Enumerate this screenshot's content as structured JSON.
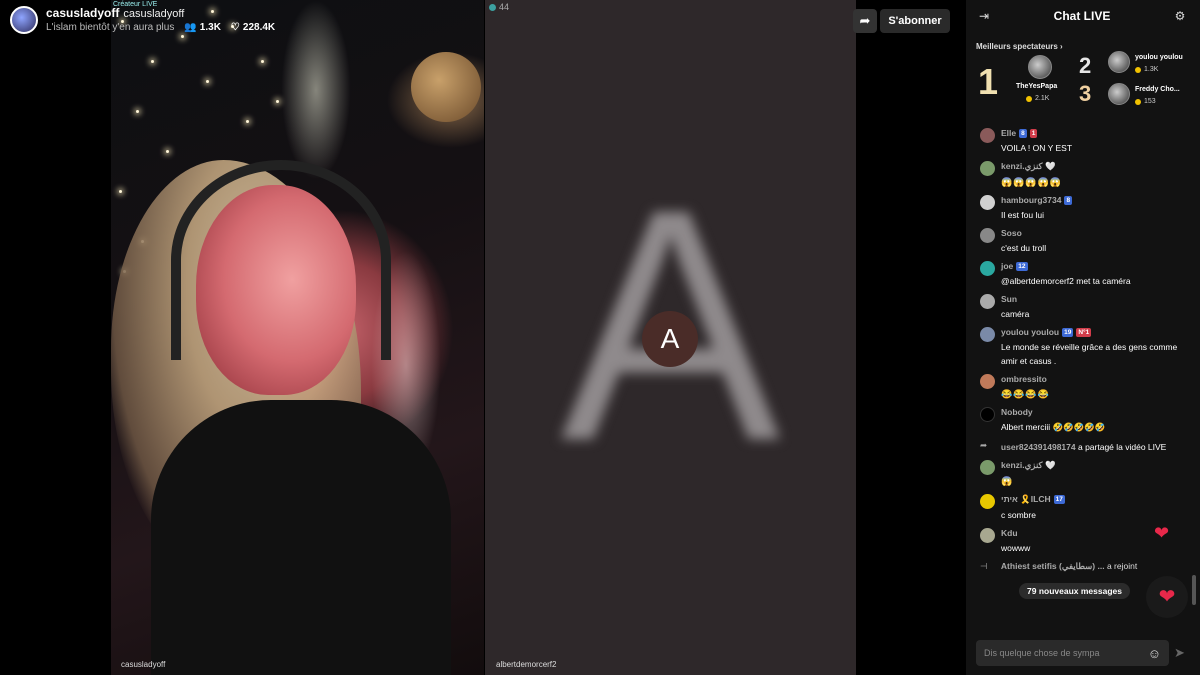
{
  "host": {
    "name": "casusladyoff",
    "handle": "casusladyoff",
    "creator_tag": "Créateur LIVE",
    "description": "L'islam bientôt y'en aura plus",
    "followers": "1.3K",
    "likes": "228.4K"
  },
  "video": {
    "left_label": "casusladyoff",
    "right_label": "albertdemorcerf2",
    "right_viewers": "44",
    "guest_initial": "A",
    "big_letter": "A"
  },
  "actions": {
    "subscribe_label": "S'abonner"
  },
  "chat": {
    "title": "Chat LIVE",
    "top_title": "Meilleurs spectateurs",
    "top_viewers": [
      {
        "rank": "1",
        "name": "TheYesPapa",
        "coins": "2.1K"
      },
      {
        "rank": "2",
        "name": "youlou youlou",
        "coins": "1.3K"
      },
      {
        "rank": "3",
        "name": "Freddy Cho...",
        "coins": "153"
      }
    ],
    "messages": [
      {
        "user": "Elle",
        "badges": [
          "8",
          "1"
        ],
        "text": "VOILA ! ON Y EST",
        "avatar_color": "#8a5a5a"
      },
      {
        "user": "kenzi.كنزي 🤍",
        "badges": [],
        "text": "😱😱😱😱😱",
        "avatar_color": "#7a9a6a"
      },
      {
        "user": "hambourg3734",
        "badges": [
          "8"
        ],
        "text": "Il est fou lui",
        "avatar_color": "#d0d0d0"
      },
      {
        "user": "Soso",
        "badges": [],
        "text": "c'est du troll",
        "avatar_color": "#888"
      },
      {
        "user": "joe",
        "badges": [
          "12"
        ],
        "text": "@albertdemorcerf2 met ta caméra",
        "avatar_color": "#2aa8a0"
      },
      {
        "user": "Sun",
        "badges": [],
        "text": "caméra",
        "avatar_color": "#aaa"
      },
      {
        "user": "youlou youlou",
        "badges": [
          "19",
          "N°1"
        ],
        "text": "Le monde se réveille grâce a des gens comme amir et casus .",
        "avatar_color": "#7a8aa8"
      },
      {
        "user": "ombressito",
        "badges": [],
        "text": "😂😂😂😂",
        "avatar_color": "#c07a5a"
      },
      {
        "user": "Nobody",
        "badges": [],
        "text": "Albert merciii 🤣🤣🤣🤣🤣",
        "avatar_color": "#000"
      },
      {
        "user": "kenzi.كنزي 🤍",
        "badges": [],
        "text": "😱",
        "avatar_color": "#7a9a6a"
      },
      {
        "user": "איתי 🎗️ILCH",
        "badges": [
          "17"
        ],
        "text": "c sombre",
        "avatar_color": "#e8c800"
      },
      {
        "user": "Kdu",
        "badges": [],
        "text": "wowww",
        "avatar_color": "#a8a890"
      }
    ],
    "share_event": {
      "user": "user824391498174",
      "text": "a partagé la vidéo LIVE"
    },
    "join_event": {
      "user": "Athiest setifis (سطايفي) ...",
      "text": "a rejoint"
    },
    "new_messages": "79 nouveaux messages",
    "input_placeholder": "Dis quelque chose de sympa"
  }
}
